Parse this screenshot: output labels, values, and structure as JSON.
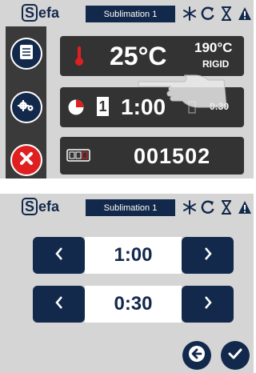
{
  "header": {
    "logo_text": "Sefa",
    "title": "Sublimation 1",
    "icons": [
      "snowflake-icon",
      "refresh-icon",
      "hourglass-icon",
      "warning-icon"
    ]
  },
  "screen1": {
    "sidebar": {
      "buttons": [
        "menu-icon",
        "settings-icon",
        "cancel-icon"
      ]
    },
    "temperature": {
      "actual": "25°C",
      "target": "190°C",
      "mode": "RIGID"
    },
    "timer": {
      "preset_index": "1",
      "time": "1:00",
      "secondary_time": "0:30"
    },
    "counter": {
      "value": "001502"
    }
  },
  "screen2": {
    "header_title": "Sublimation 1",
    "steppers": [
      {
        "value": "1:00"
      },
      {
        "value": "0:30"
      }
    ],
    "buttons": [
      "back-icon",
      "confirm-icon"
    ]
  },
  "colors": {
    "navy": "#13294b",
    "panel": "#d5d5d5",
    "dark": "#333333",
    "red": "#e02020"
  }
}
